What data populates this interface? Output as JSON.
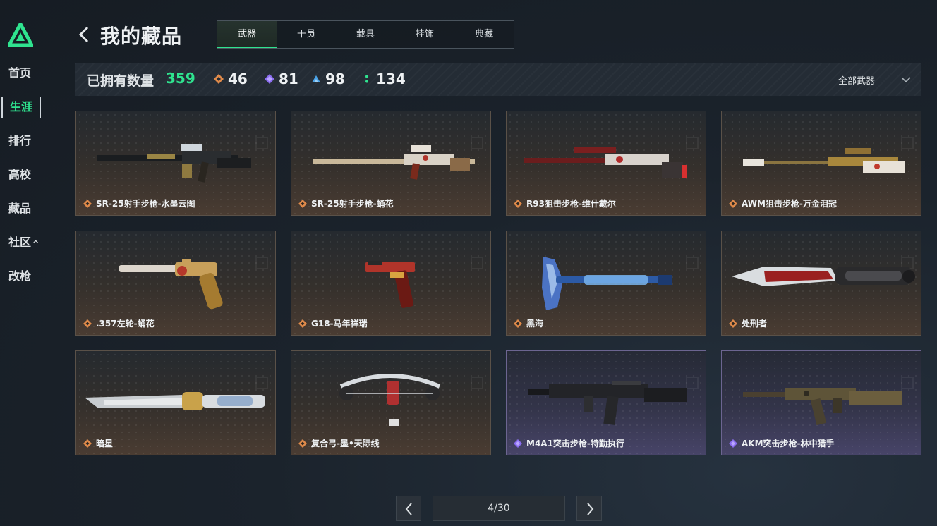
{
  "sidebar": {
    "items": [
      {
        "label": "首页"
      },
      {
        "label": "生涯",
        "active": true
      },
      {
        "label": "排行"
      },
      {
        "label": "高校"
      },
      {
        "label": "藏品"
      },
      {
        "label": "社区",
        "caret": "^"
      },
      {
        "label": "改枪"
      }
    ]
  },
  "header": {
    "title": "我的藏品",
    "tabs": [
      {
        "label": "武器",
        "active": true
      },
      {
        "label": "干员"
      },
      {
        "label": "载具"
      },
      {
        "label": "挂饰"
      },
      {
        "label": "典藏"
      }
    ]
  },
  "stats": {
    "owned_label": "已拥有数量",
    "owned_count": "359",
    "rarities": [
      {
        "icon": "orange-diamond-icon",
        "color": "#e08a4a",
        "count": "46"
      },
      {
        "icon": "purple-diamond-icon",
        "color": "#8a6cf0",
        "count": "81"
      },
      {
        "icon": "blue-triangle-icon",
        "color": "#4aa3e8",
        "count": "98"
      },
      {
        "icon": "green-dots-icon",
        "color": "#2fe38f",
        "count": "134"
      }
    ],
    "filter": {
      "label": "全部武器",
      "icon": "chevron-down-icon"
    }
  },
  "items": [
    {
      "name": "SR-25射手步枪-水墨云图",
      "rarity": "orange"
    },
    {
      "name": "SR-25射手步枪-蛹花",
      "rarity": "orange"
    },
    {
      "name": "R93狙击步枪-维什戴尔",
      "rarity": "orange"
    },
    {
      "name": "AWM狙击步枪-万金泪冠",
      "rarity": "orange"
    },
    {
      "name": ".357左轮-蛹花",
      "rarity": "orange"
    },
    {
      "name": "G18-马年祥瑞",
      "rarity": "orange"
    },
    {
      "name": "黑海",
      "rarity": "orange"
    },
    {
      "name": "处刑者",
      "rarity": "orange"
    },
    {
      "name": "暗星",
      "rarity": "orange"
    },
    {
      "name": "复合弓-墨•天际线",
      "rarity": "orange"
    },
    {
      "name": "M4A1突击步枪-特勤执行",
      "rarity": "purple"
    },
    {
      "name": "AKM突击步枪-林中猎手",
      "rarity": "purple"
    }
  ],
  "pagination": {
    "text": "4/30"
  },
  "colors": {
    "accent": "#2fe38f",
    "orange": "#e08a4a",
    "purple": "#8a6cf0"
  }
}
